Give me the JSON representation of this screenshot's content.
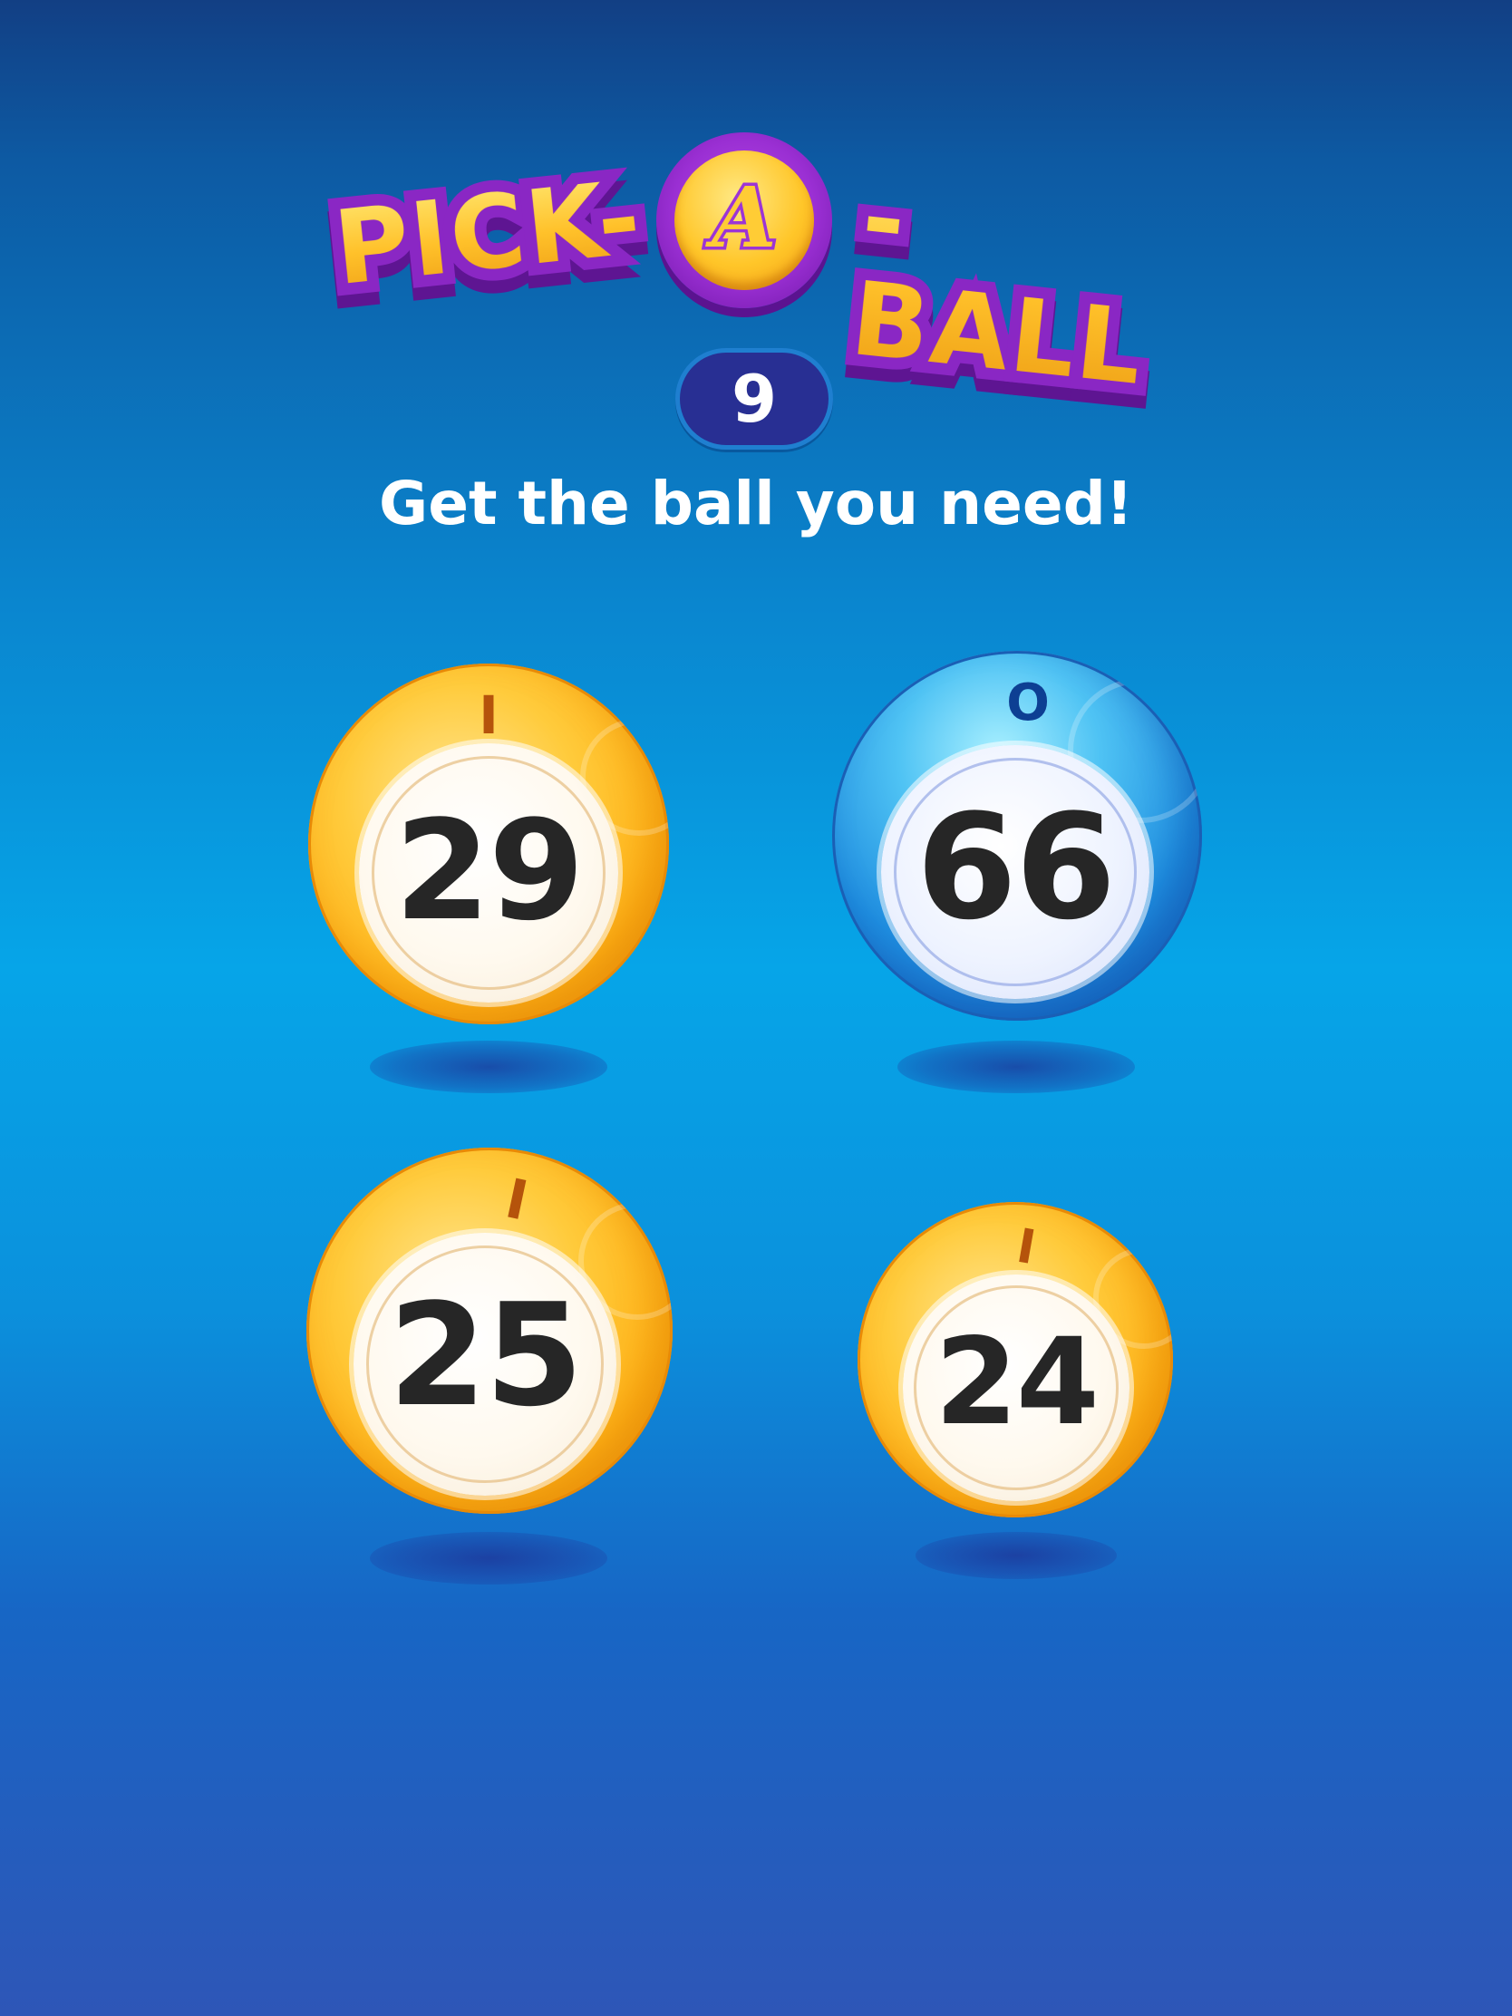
{
  "logo": {
    "left_word": "PICK-",
    "coin_letter": "A",
    "right_word": "-BALL"
  },
  "counter": {
    "value": "9"
  },
  "subtitle": "Get the ball you need!",
  "balls": [
    {
      "letter": "I",
      "number": "29",
      "color": "yellow"
    },
    {
      "letter": "O",
      "number": "66",
      "color": "blue"
    },
    {
      "letter": "I",
      "number": "25",
      "color": "yellow"
    },
    {
      "letter": "I",
      "number": "24",
      "color": "yellow"
    }
  ],
  "colors": {
    "ball_yellow": "#ffb114",
    "ball_blue": "#1f8ee0",
    "logo_gold": "#ffc629",
    "logo_purple": "#9a2fd3",
    "counter_bg": "#282f93"
  }
}
